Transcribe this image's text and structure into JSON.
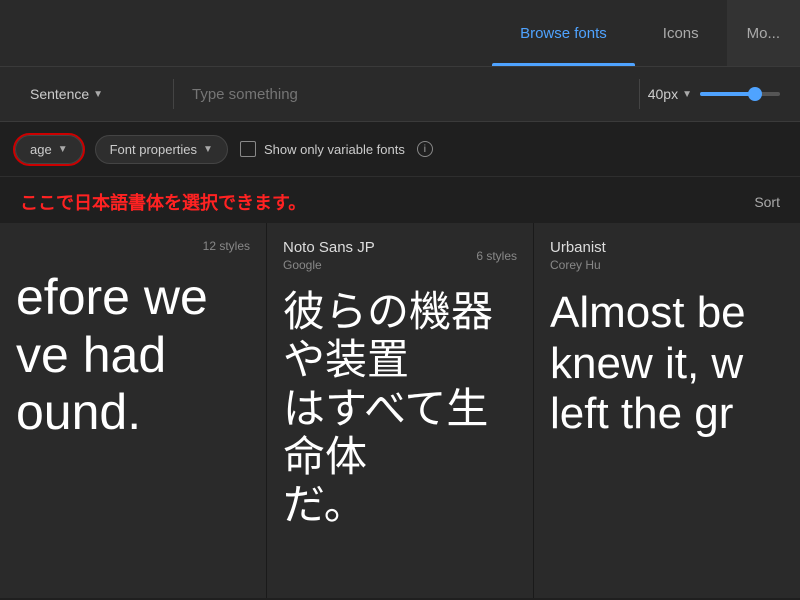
{
  "nav": {
    "tabs": [
      {
        "id": "browse-fonts",
        "label": "Browse fonts",
        "active": true
      },
      {
        "id": "icons",
        "label": "Icons",
        "active": false
      },
      {
        "id": "more",
        "label": "Mo...",
        "active": false
      }
    ]
  },
  "toolbar": {
    "sentence_label": "Sentence",
    "type_placeholder": "Type something",
    "size_label": "40px",
    "size_value": 40
  },
  "filters": {
    "language_label": "age",
    "language_full": "Language",
    "font_properties_label": "Font properties",
    "variable_fonts_label": "Show only variable fonts",
    "info_icon_label": "i"
  },
  "alert": {
    "text": "ここで日本語書体を選択できます。",
    "sort_label": "Sort"
  },
  "font_cards": [
    {
      "id": "card-1",
      "name": "",
      "foundry": "",
      "styles_count": "12 styles",
      "preview_text": "efore we\nve had\nound.",
      "type": "latin"
    },
    {
      "id": "card-2",
      "name": "Noto Sans JP",
      "foundry": "Google",
      "styles_count": "6 styles",
      "preview_text": "彼らの機器や装置\nはすべて生命体\nだ。",
      "type": "jp"
    },
    {
      "id": "card-3",
      "name": "Urbanist",
      "foundry": "Corey Hu",
      "styles_count": "",
      "preview_text": "Almost be\nknew it, w\nleft the gr",
      "type": "latin"
    }
  ]
}
